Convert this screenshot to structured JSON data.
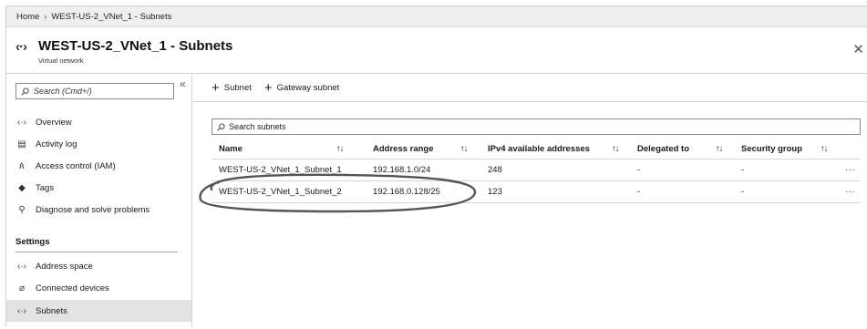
{
  "breadcrumb": {
    "home": "Home",
    "separator": "›",
    "current": "WEST-US-2_VNet_1 - Subnets"
  },
  "header": {
    "icon": "vnet-icon",
    "icon_glyph": "‹·›",
    "title": "WEST-US-2_VNet_1 - Subnets",
    "subtitle": "Virtual network",
    "close": "✕"
  },
  "sidebar": {
    "search_placeholder": "Search (Cmd+/)",
    "collapse": "«",
    "items": [
      {
        "label": "Overview",
        "icon": "vnet-icon",
        "glyph": "‹·›"
      },
      {
        "label": "Activity log",
        "icon": "activity-log-icon",
        "glyph": "▤"
      },
      {
        "label": "Access control (IAM)",
        "icon": "people-icon",
        "glyph": "ጰ"
      },
      {
        "label": "Tags",
        "icon": "tag-icon",
        "glyph": "◆"
      },
      {
        "label": "Diagnose and solve problems",
        "icon": "wrench-icon",
        "glyph": "⚲"
      }
    ],
    "settings_label": "Settings",
    "settings_items": [
      {
        "label": "Address space",
        "icon": "vnet-icon",
        "glyph": "‹·›"
      },
      {
        "label": "Connected devices",
        "icon": "plug-icon",
        "glyph": "⌀"
      },
      {
        "label": "Subnets",
        "icon": "vnet-icon",
        "glyph": "‹·›",
        "active": true
      }
    ]
  },
  "toolbar": {
    "add_subnet": "Subnet",
    "add_gateway_subnet": "Gateway subnet",
    "plus": "+"
  },
  "subnets": {
    "search_placeholder": "Search subnets",
    "sort_glyph": "↑↓",
    "more_glyph": "···",
    "columns": [
      "Name",
      "Address range",
      "IPv4 available addresses",
      "Delegated to",
      "Security group"
    ],
    "rows": [
      {
        "name": "WEST-US-2_VNet_1_Subnet_1",
        "address_range": "192.168.1.0/24",
        "ipv4_available": "248",
        "delegated_to": "-",
        "security_group": "-"
      },
      {
        "name": "WEST-US-2_VNet_1_Subnet_2",
        "address_range": "192.168.0.128/25",
        "ipv4_available": "123",
        "delegated_to": "-",
        "security_group": "-"
      }
    ]
  },
  "colors": {
    "breadcrumb_bg": "#efefef",
    "active_nav_bg": "#e3e3e3",
    "annotation_ellipse": "#555555"
  }
}
